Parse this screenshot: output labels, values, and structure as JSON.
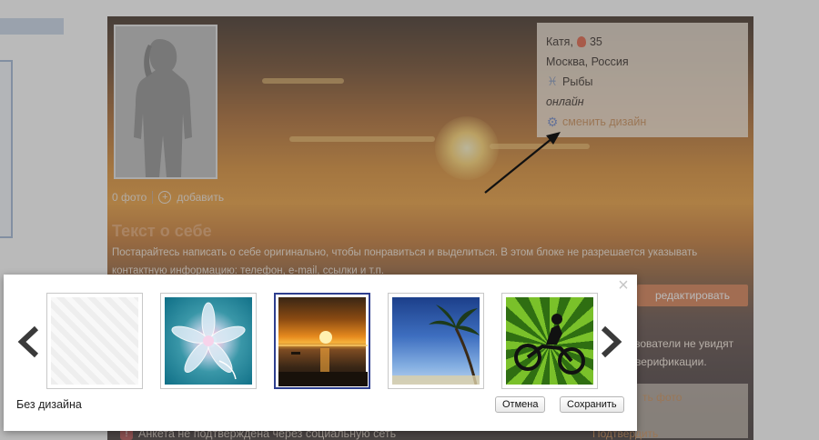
{
  "profile": {
    "name_age": "Катя,",
    "age": "35",
    "location": "Москва, Россия",
    "zodiac": "Рыбы",
    "status": "онлайн",
    "change_design": "сменить дизайн",
    "photos_count": "0 фото",
    "add_photo": "добавить",
    "about_title": "Текст о себе",
    "about_text": "Постарайтесь написать о себе оригинально, чтобы понравиться и выделиться. В этом блоке не разрешается указывать контактную информацию: телефон, e-mail, ссылки и т.п.",
    "edit_button": "редактировать",
    "partial_line1": "зователи не увидят",
    "partial_line2": "верификации.",
    "photo_box_label": "ть фото",
    "confirm_link": "Подтвердить",
    "notice": "Анкета не подтверждена через социальную сеть"
  },
  "design_modal": {
    "close_label": "×",
    "prev_arrow": "‹",
    "next_arrow": "›",
    "themes": [
      {
        "id": "none",
        "icon": "pattern-thumbnail"
      },
      {
        "id": "flower",
        "icon": "flower-thumbnail"
      },
      {
        "id": "sunset",
        "icon": "sunset-thumbnail",
        "selected": true
      },
      {
        "id": "palm",
        "icon": "palm-thumbnail"
      },
      {
        "id": "moto",
        "icon": "motorcycle-thumbnail"
      }
    ],
    "selected_theme_label": "Без дизайна",
    "cancel_button": "Отмена",
    "save_button": "Сохранить"
  },
  "colors": {
    "accent": "#d67b4d",
    "link": "#c98a52",
    "selected_border": "#2e3f8f"
  }
}
